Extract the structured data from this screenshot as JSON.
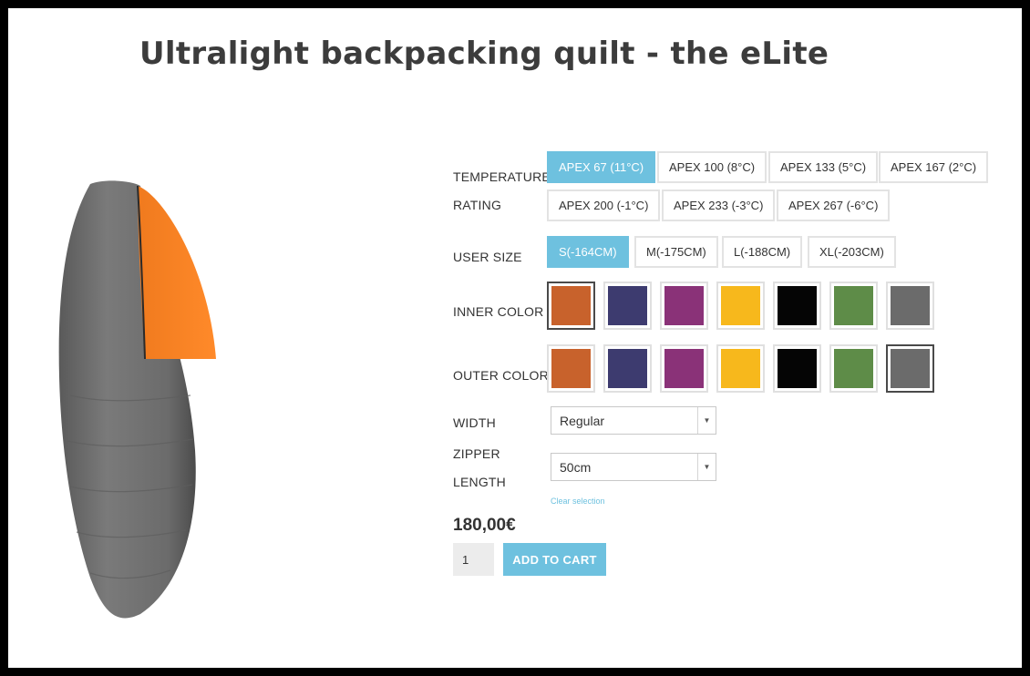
{
  "page": {
    "title": "Ultralight backpacking quilt - the eLite"
  },
  "temperature": {
    "label_line1": "TEMPERATURE",
    "label_line2": "RATING",
    "options": [
      "APEX 67 (11°C)",
      "APEX 100 (8°C)",
      "APEX 133 (5°C)",
      "APEX 167 (2°C)",
      "APEX 200 (-1°C)",
      "APEX 233 (-3°C)",
      "APEX 267 (-6°C)"
    ],
    "selected": "APEX 67 (11°C)"
  },
  "user_size": {
    "label": "USER SIZE",
    "options": [
      "S(-164CM)",
      "M(-175CM)",
      "L(-188CM)",
      "XL(-203CM)"
    ],
    "selected": "S(-164CM)"
  },
  "inner_color": {
    "label": "INNER COLOR",
    "colors": [
      "#c8622c",
      "#3d3b6f",
      "#8a3278",
      "#f7b81c",
      "#050505",
      "#5e8c48",
      "#6b6b6b"
    ],
    "selected_index": 0
  },
  "outer_color": {
    "label": "OUTER COLOR",
    "colors": [
      "#c8622c",
      "#3d3b6f",
      "#8a3278",
      "#f7b81c",
      "#050505",
      "#5e8c48",
      "#6b6b6b"
    ],
    "selected_index": 6
  },
  "width": {
    "label": "WIDTH",
    "value": "Regular"
  },
  "zipper": {
    "label_line1": "ZIPPER",
    "label_line2": "LENGTH",
    "value": "50cm"
  },
  "clear_selection": "Clear selection",
  "price": "180,00€",
  "quantity": "1",
  "add_to_cart": "ADD TO CART",
  "accent_color": "#6ec1df"
}
